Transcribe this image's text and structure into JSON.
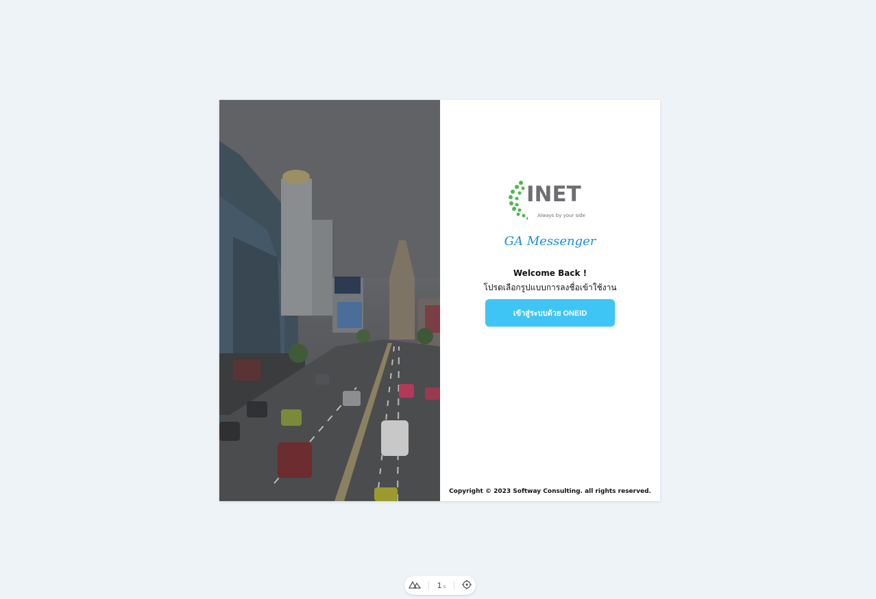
{
  "brand": {
    "logo_text": "INET",
    "tagline": "Always by your side",
    "app_name": "GA Messenger"
  },
  "login": {
    "welcome": "Welcome Back !",
    "subtitle": "โปรดเลือกรูปแบบการลงชื่อเข้าใช้งาน",
    "oneid_button": "เข้าสู่ระบบด้วย ONEID"
  },
  "footer": {
    "copyright": "Copyright © 2023 Softway Consulting. all rights reserved."
  },
  "devtools": {
    "count": "1",
    "unit": "s"
  },
  "colors": {
    "page_bg": "#eef3f8",
    "button": "#3fc5f5",
    "app_name": "#1a8fd6",
    "logo_green": "#4cb848"
  },
  "icons": [
    "nuxt-icon",
    "target-icon"
  ]
}
